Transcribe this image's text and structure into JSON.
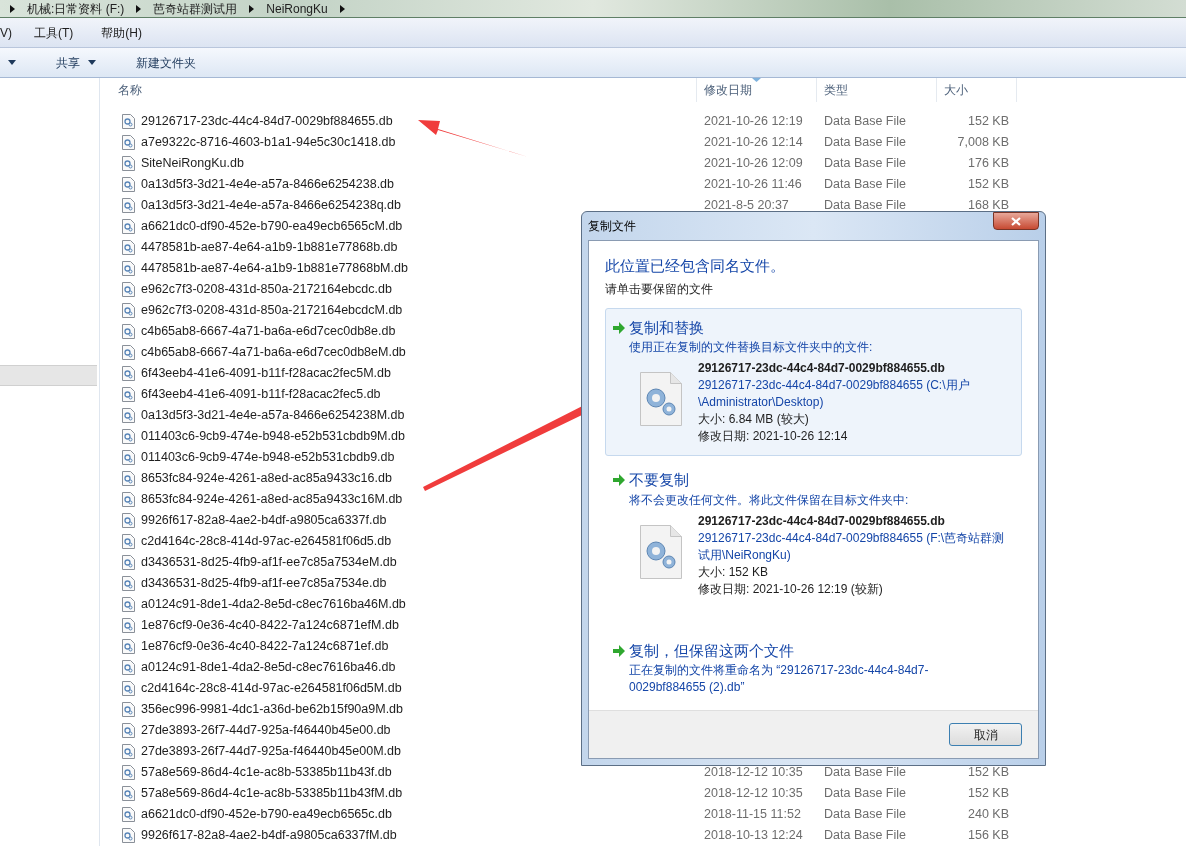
{
  "breadcrumb": [
    "机械:日常资料 (F:)",
    "芭奇站群测试用",
    "NeiRongKu"
  ],
  "menu": [
    "V)",
    "工具(T)",
    "帮助(H)"
  ],
  "toolbar": [
    {
      "kind": "caret"
    },
    {
      "kind": "dropdown",
      "label": "共享"
    },
    {
      "kind": "button",
      "label": "新建文件夹"
    }
  ],
  "columns": [
    {
      "label": "名称",
      "sorted": false
    },
    {
      "label": "修改日期",
      "sorted": true
    },
    {
      "label": "类型",
      "sorted": false
    },
    {
      "label": "大小",
      "sorted": false
    }
  ],
  "files": [
    {
      "name": "29126717-23dc-44c4-84d7-0029bf884655.db",
      "date": "2021-10-26 12:19",
      "type": "Data Base File",
      "size": "152 KB"
    },
    {
      "name": "a7e9322c-8716-4603-b1a1-94e5c30c1418.db",
      "date": "2021-10-26 12:14",
      "type": "Data Base File",
      "size": "7,008 KB"
    },
    {
      "name": "SiteNeiRongKu.db",
      "date": "2021-10-26 12:09",
      "type": "Data Base File",
      "size": "176 KB"
    },
    {
      "name": "0a13d5f3-3d21-4e4e-a57a-8466e6254238.db",
      "date": "2021-10-26 11:46",
      "type": "Data Base File",
      "size": "152 KB"
    },
    {
      "name": "0a13d5f3-3d21-4e4e-a57a-8466e6254238q.db",
      "date": "2021-8-5 20:37",
      "type": "Data Base File",
      "size": "168 KB"
    },
    {
      "name": "a6621dc0-df90-452e-b790-ea49ecb6565cM.db"
    },
    {
      "name": "4478581b-ae87-4e64-a1b9-1b881e77868b.db"
    },
    {
      "name": "4478581b-ae87-4e64-a1b9-1b881e77868bM.db"
    },
    {
      "name": "e962c7f3-0208-431d-850a-2172164ebcdc.db"
    },
    {
      "name": "e962c7f3-0208-431d-850a-2172164ebcdcM.db"
    },
    {
      "name": "c4b65ab8-6667-4a71-ba6a-e6d7cec0db8e.db"
    },
    {
      "name": "c4b65ab8-6667-4a71-ba6a-e6d7cec0db8eM.db"
    },
    {
      "name": "6f43eeb4-41e6-4091-b11f-f28acac2fec5M.db"
    },
    {
      "name": "6f43eeb4-41e6-4091-b11f-f28acac2fec5.db"
    },
    {
      "name": "0a13d5f3-3d21-4e4e-a57a-8466e6254238M.db"
    },
    {
      "name": "011403c6-9cb9-474e-b948-e52b531cbdb9M.db"
    },
    {
      "name": "011403c6-9cb9-474e-b948-e52b531cbdb9.db"
    },
    {
      "name": "8653fc84-924e-4261-a8ed-ac85a9433c16.db"
    },
    {
      "name": "8653fc84-924e-4261-a8ed-ac85a9433c16M.db"
    },
    {
      "name": "9926f617-82a8-4ae2-b4df-a9805ca6337f.db"
    },
    {
      "name": "c2d4164c-28c8-414d-97ac-e264581f06d5.db"
    },
    {
      "name": "d3436531-8d25-4fb9-af1f-ee7c85a7534eM.db"
    },
    {
      "name": "d3436531-8d25-4fb9-af1f-ee7c85a7534e.db"
    },
    {
      "name": "a0124c91-8de1-4da2-8e5d-c8ec7616ba46M.db"
    },
    {
      "name": "1e876cf9-0e36-4c40-8422-7a124c6871efM.db"
    },
    {
      "name": "1e876cf9-0e36-4c40-8422-7a124c6871ef.db"
    },
    {
      "name": "a0124c91-8de1-4da2-8e5d-c8ec7616ba46.db"
    },
    {
      "name": "c2d4164c-28c8-414d-97ac-e264581f06d5M.db"
    },
    {
      "name": "356ec996-9981-4dc1-a36d-be62b15f90a9M.db"
    },
    {
      "name": "27de3893-26f7-44d7-925a-f46440b45e00.db"
    },
    {
      "name": "27de3893-26f7-44d7-925a-f46440b45e00M.db"
    },
    {
      "name": "57a8e569-86d4-4c1e-ac8b-53385b11b43f.db",
      "date": "2018-12-12 10:35",
      "type": "Data Base File",
      "size": "152 KB"
    },
    {
      "name": "57a8e569-86d4-4c1e-ac8b-53385b11b43fM.db",
      "date": "2018-12-12 10:35",
      "type": "Data Base File",
      "size": "152 KB"
    },
    {
      "name": "a6621dc0-df90-452e-b790-ea49ecb6565c.db",
      "date": "2018-11-15 11:52",
      "type": "Data Base File",
      "size": "240 KB"
    },
    {
      "name": "9926f617-82a8-4ae2-b4df-a9805ca6337fM.db",
      "date": "2018-10-13 12:24",
      "type": "Data Base File",
      "size": "156 KB"
    }
  ],
  "dialog": {
    "title": "复制文件",
    "heading": "此位置已经包含同名文件。",
    "prompt": "请单击要保留的文件",
    "options": [
      {
        "kind": "file",
        "highlighted": true,
        "title": "复制和替换",
        "description": "使用正在复制的文件替换目标文件夹中的文件:",
        "file_name": "29126717-23dc-44c4-84d7-0029bf884655.db",
        "path": "29126717-23dc-44c4-84d7-0029bf884655 (C:\\用户\\Administrator\\Desktop)",
        "size": "大小: 6.84 MB (较大)",
        "modified": "修改日期: 2021-10-26 12:14"
      },
      {
        "kind": "file",
        "highlighted": false,
        "title": "不要复制",
        "description": "将不会更改任何文件。将此文件保留在目标文件夹中:",
        "file_name": "29126717-23dc-44c4-84d7-0029bf884655.db",
        "path": "29126717-23dc-44c4-84d7-0029bf884655 (F:\\芭奇站群测试用\\NeiRongKu)",
        "size": "大小: 152 KB",
        "modified": "修改日期: 2021-10-26 12:19 (较新)"
      },
      {
        "kind": "text",
        "highlighted": false,
        "title": "复制，但保留这两个文件",
        "description": "正在复制的文件将重命名为 “29126717-23dc-44c4-84d7-0029bf884655 (2).db”"
      }
    ],
    "button": "取消"
  }
}
